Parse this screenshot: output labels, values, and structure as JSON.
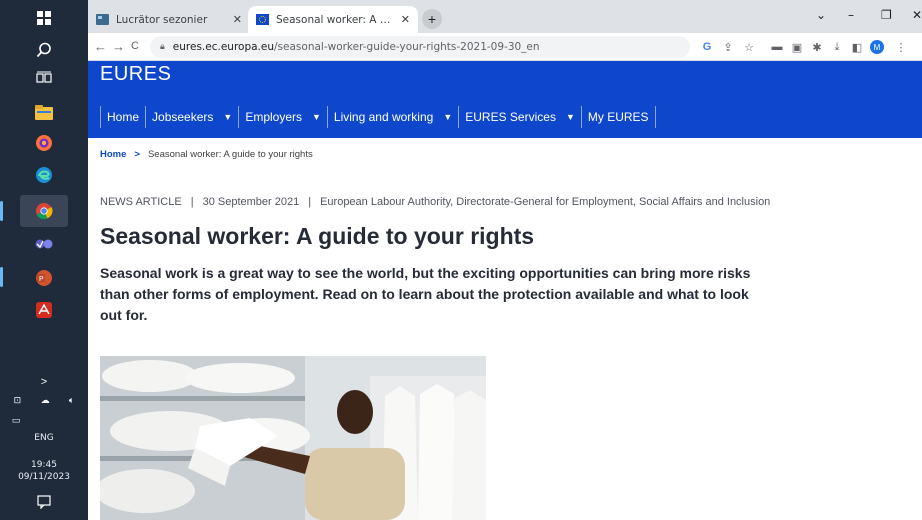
{
  "taskbar": {
    "lang": "ENG",
    "time": "19:45",
    "date": "09/11/2023"
  },
  "tabs": [
    {
      "title": "Lucrător sezonier",
      "active": false
    },
    {
      "title": "Seasonal worker: A guide to you",
      "active": true
    }
  ],
  "new_tab": "+",
  "window_controls": {
    "dropdown": "⌄",
    "minimize": "–",
    "restore": "❐",
    "close": "✕"
  },
  "toolbar": {
    "back": "←",
    "forward": "→",
    "reload": "C",
    "url_host": "eures.ec.europa.eu",
    "url_path": "/seasonal-worker-guide-your-rights-2021-09-30_en",
    "profile_initial": "M"
  },
  "site": {
    "title": "EURES",
    "nav": [
      {
        "label": "Home",
        "dropdown": false
      },
      {
        "label": "Jobseekers",
        "dropdown": true
      },
      {
        "label": "Employers",
        "dropdown": true
      },
      {
        "label": "Living and working",
        "dropdown": true
      },
      {
        "label": "EURES Services",
        "dropdown": true
      },
      {
        "label": "My EURES",
        "dropdown": false
      }
    ],
    "brand_color": "#0e47cb"
  },
  "breadcrumb": {
    "home": "Home",
    "separator": ">",
    "current": "Seasonal worker: A guide to your rights"
  },
  "article": {
    "type": "NEWS ARTICLE",
    "date": "30 September 2021",
    "authors": "European Labour Authority, Directorate-General for Employment, Social Affairs and Inclusion",
    "headline": "Seasonal worker: A guide to your rights",
    "lead": "Seasonal work is a great way to see the world, but the exciting opportunities can bring more risks than other forms of employment. Read on to learn about the protection available and what to look out for."
  }
}
